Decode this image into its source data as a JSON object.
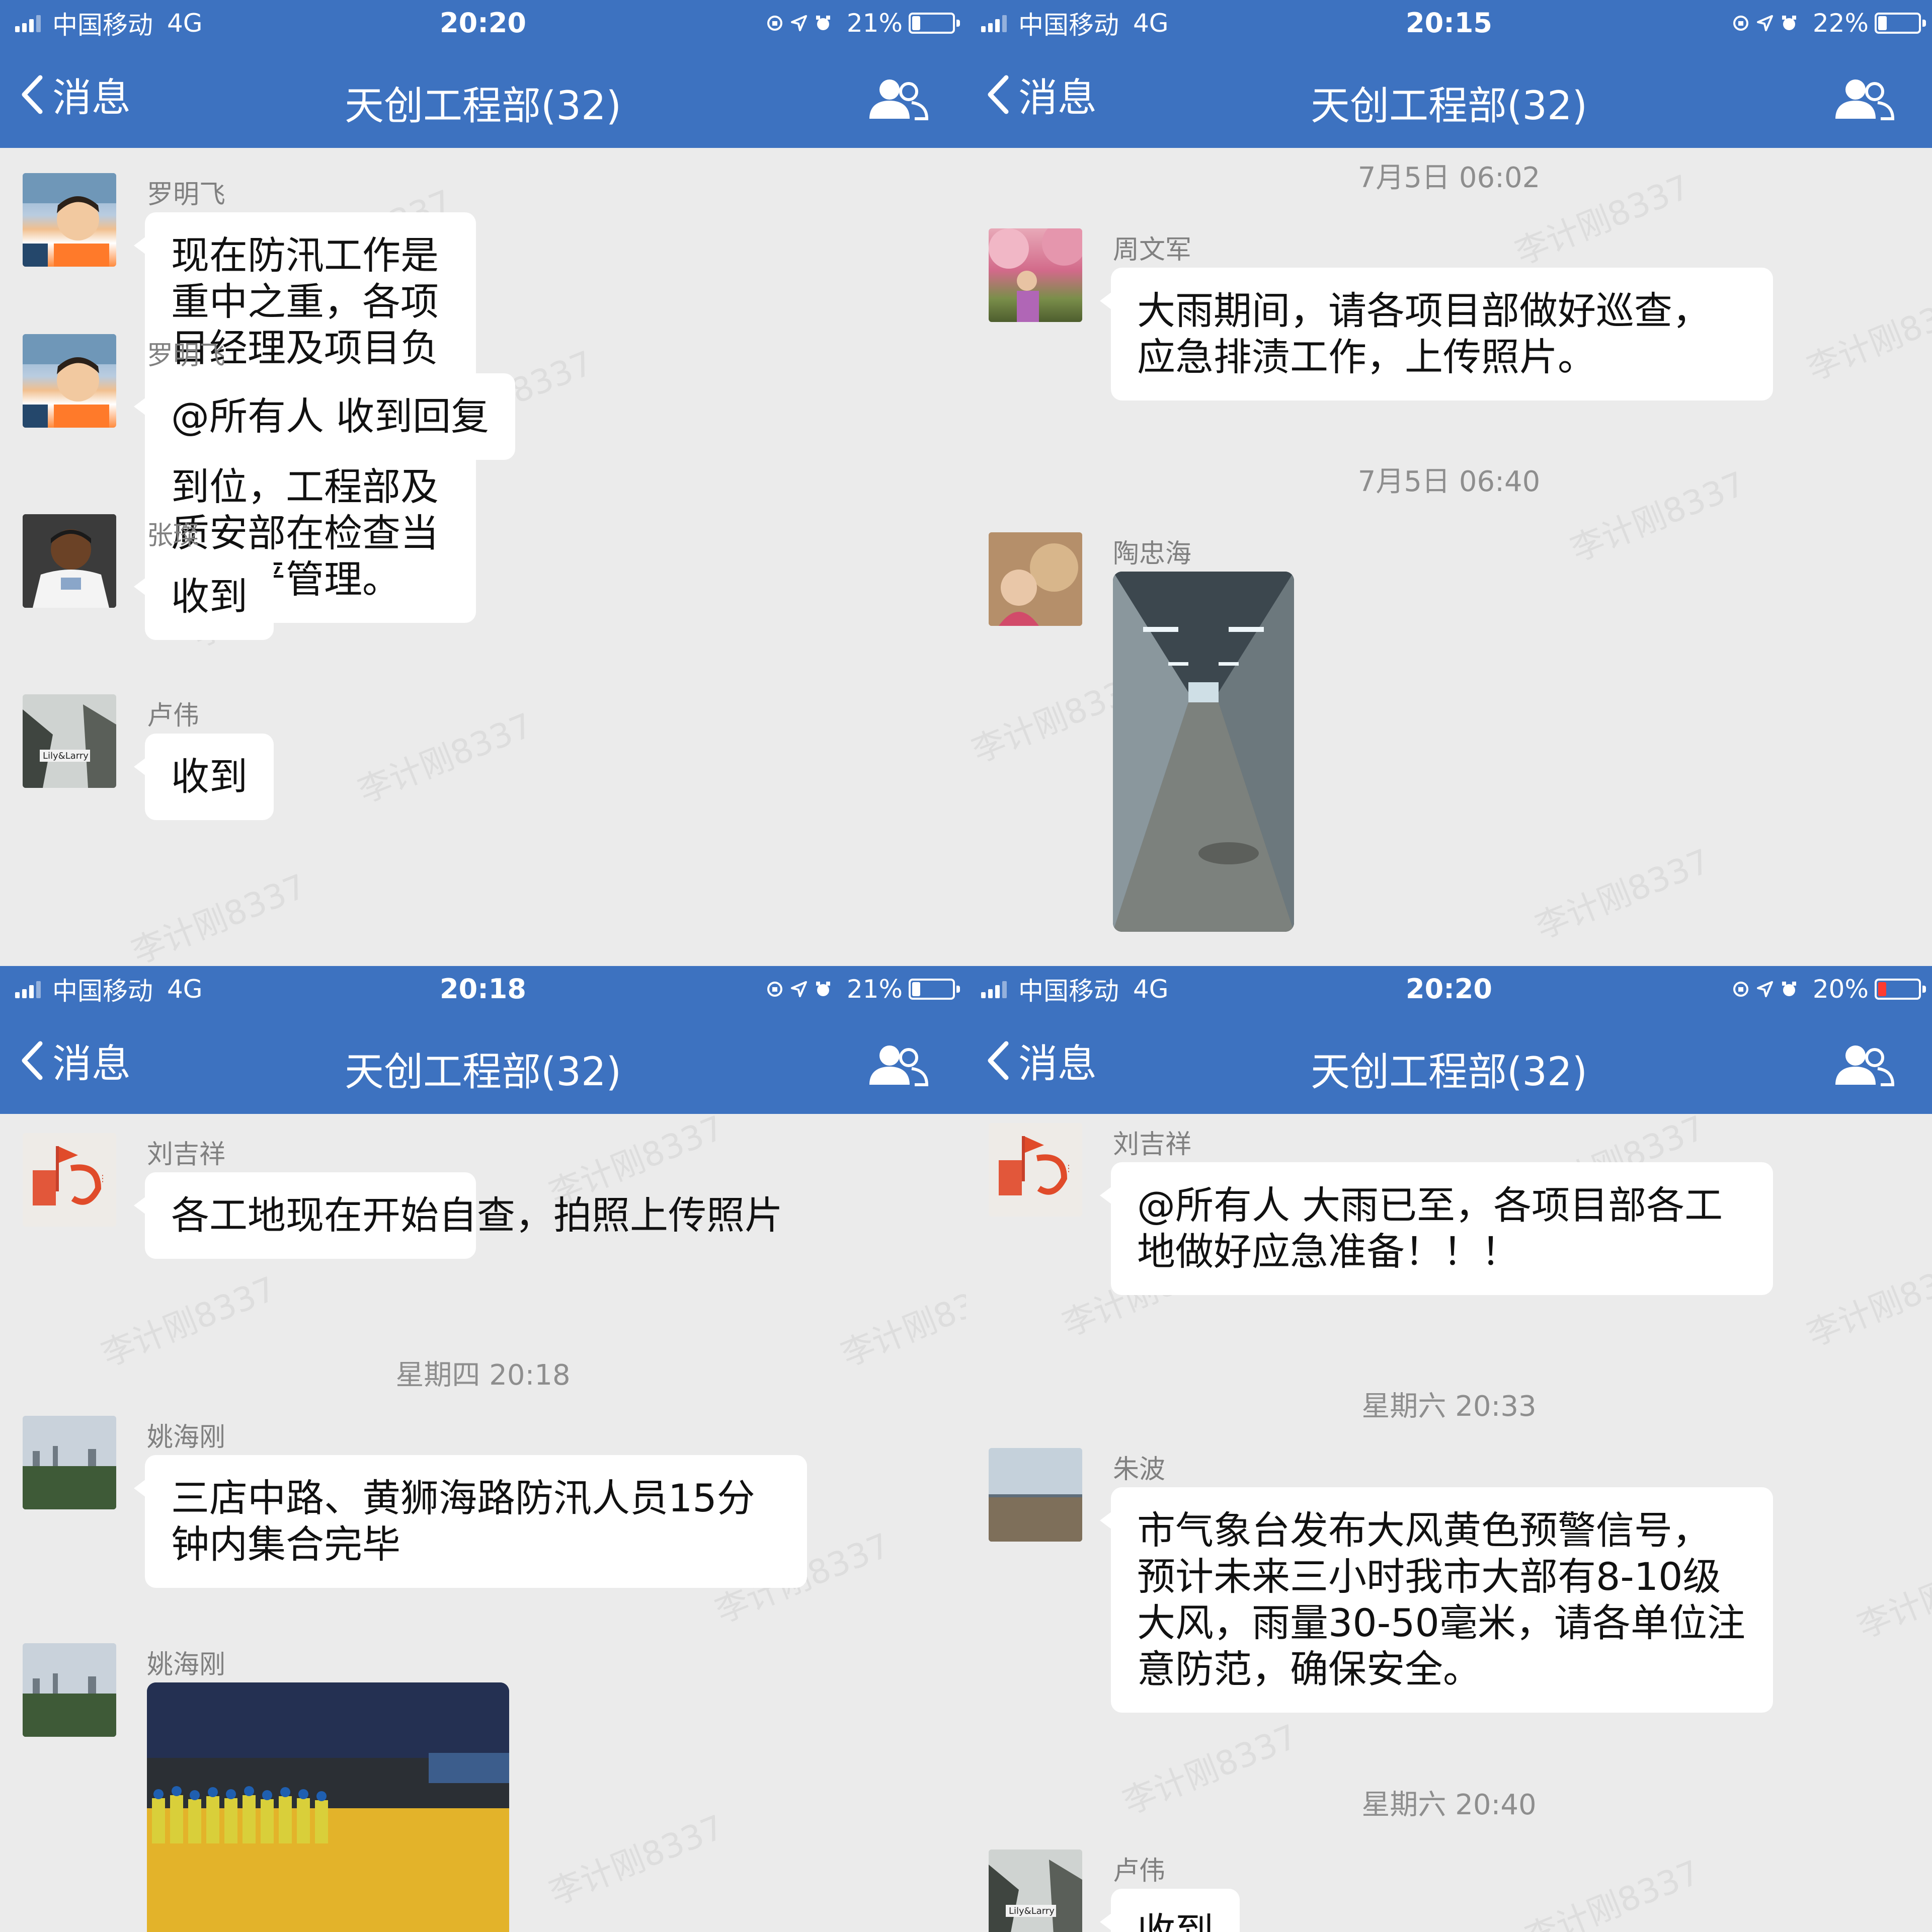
{
  "panels": [
    {
      "status": {
        "carrier": "中国移动",
        "network": "4G",
        "time": "20:20",
        "battery": "21%",
        "battery_level": 0.21,
        "battery_color": "#ffffff"
      },
      "nav": {
        "back": "消息",
        "title": "天创工程部(32)"
      },
      "messages": [
        {
          "sender": "罗明飞",
          "text": "现在防汛工作是重中之重，各项目经理及项目负责人严格按照中午会议要求落实到位，工程部及质安部在检查当中从严管理。"
        },
        {
          "sender": "罗明飞",
          "text": "@所有人 收到回复"
        },
        {
          "sender": "张璨",
          "text": "收到"
        },
        {
          "sender": "卢伟",
          "text": "收到"
        }
      ]
    },
    {
      "status": {
        "carrier": "中国移动",
        "network": "4G",
        "time": "20:15",
        "battery": "22%",
        "battery_level": 0.22,
        "battery_color": "#ffffff"
      },
      "nav": {
        "back": "消息",
        "title": "天创工程部(32)"
      },
      "timestamps": [
        "7月5日 06:02",
        "7月5日 06:40"
      ],
      "messages": [
        {
          "sender": "周文军",
          "text": "大雨期间，请各项目部做好巡查，应急排渍工作，上传照片。"
        },
        {
          "sender": "陶忠海",
          "image": "photo of underground tunnel corridor"
        }
      ]
    },
    {
      "status": {
        "carrier": "中国移动",
        "network": "4G",
        "time": "20:18",
        "battery": "21%",
        "battery_level": 0.21,
        "battery_color": "#ffffff"
      },
      "nav": {
        "back": "消息",
        "title": "天创工程部(32)"
      },
      "timestamps": [
        "星期四 20:18"
      ],
      "messages": [
        {
          "sender": "刘吉祥",
          "text": "各工地现在开始自查，拍照上传照片"
        },
        {
          "sender": "姚海刚",
          "text": "三店中路、黄狮海路防汛人员15分钟内集合完毕"
        },
        {
          "sender": "姚海刚",
          "image": "photo of workers in safety vests at night"
        }
      ]
    },
    {
      "status": {
        "carrier": "中国移动",
        "network": "4G",
        "time": "20:20",
        "battery": "20%",
        "battery_level": 0.2,
        "battery_color": "#ff3b30"
      },
      "nav": {
        "back": "消息",
        "title": "天创工程部(32)"
      },
      "timestamps": [
        "星期六 20:33",
        "星期六 20:40"
      ],
      "messages": [
        {
          "sender": "刘吉祥",
          "text": "@所有人 大雨已至，各项目部各工地做好应急准备！！！"
        },
        {
          "sender": "朱波",
          "text": "市气象台发布大风黄色预警信号，预计未来三小时我市大部有8-10级大风，雨量30-50毫米，请各单位注意防范，确保安全。"
        },
        {
          "sender": "卢伟",
          "text": "收到"
        }
      ]
    }
  ],
  "watermark": "李计刚8337",
  "colors": {
    "nav_bar": "#3d72c0",
    "chat_bg": "#ebebeb",
    "bubble": "#ffffff",
    "meta_text": "#8e8e8e"
  },
  "icons": [
    "signal-icon",
    "orientation-lock-icon",
    "location-icon",
    "alarm-icon",
    "battery-icon",
    "back-chevron-icon",
    "group-members-icon"
  ]
}
